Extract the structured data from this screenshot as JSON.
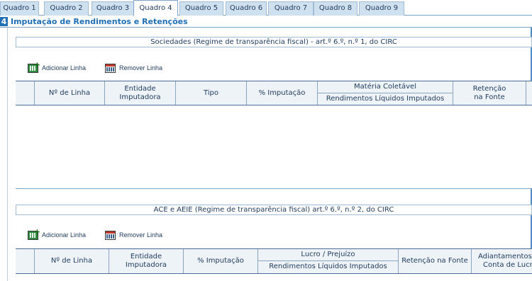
{
  "tabs": [
    {
      "label": "Quadro 1",
      "active": false
    },
    {
      "label": "Quadro 2",
      "active": false
    },
    {
      "label": "Quadro 3",
      "active": false
    },
    {
      "label": "Quadro 4",
      "active": true
    },
    {
      "label": "Quadro 5",
      "active": false
    },
    {
      "label": "Quadro 6",
      "active": false
    },
    {
      "label": "Quadro 7",
      "active": false
    },
    {
      "label": "Quadro 8",
      "active": false
    },
    {
      "label": "Quadro 9",
      "active": false
    }
  ],
  "section": {
    "number": "4",
    "title": "Imputação de Rendimentos e Retenções"
  },
  "table1": {
    "subtitle": "Sociedades (Regime de transparência fiscal) - art.º 6.º, n.º 1, do CIRC",
    "add_label": "Adicionar Linha",
    "remove_label": "Remover Linha",
    "col_linha": "Nº de Linha",
    "col_entidade": "Entidade Imputadora",
    "col_tipo": "Tipo",
    "col_imputacao": "% Imputação",
    "col_materia": "Matéria Coletável",
    "col_rendimentos": "Rendimentos Líquidos Imputados",
    "col_retencao_1": "Retenção",
    "col_retencao_2": "na Fonte"
  },
  "table2": {
    "subtitle": "ACE e AEIE (Regime de transparência fiscal) art.º 6.º, n.º 2, do CIRC",
    "add_label": "Adicionar Linha",
    "remove_label": "Remover Linha",
    "col_linha": "Nº de Linha",
    "col_entidade": "Entidade Imputadora",
    "col_imputacao": "% Imputação",
    "col_lucro": "Lucro / Prejuízo",
    "col_rendimentos": "Rendimentos Líquidos Imputados",
    "col_retencao": "Retenção na Fonte",
    "col_adiantamentos_1": "Adiantamentos",
    "col_adiantamentos_2": "Conta de Lucro"
  },
  "colors": {
    "accent": "#1f6fb5",
    "tab_bg": "#cfe0ef",
    "header_bg": "#eef3f8",
    "border": "#7ea3c7"
  },
  "icons": {
    "add": "add-row-icon",
    "remove": "remove-row-icon"
  }
}
